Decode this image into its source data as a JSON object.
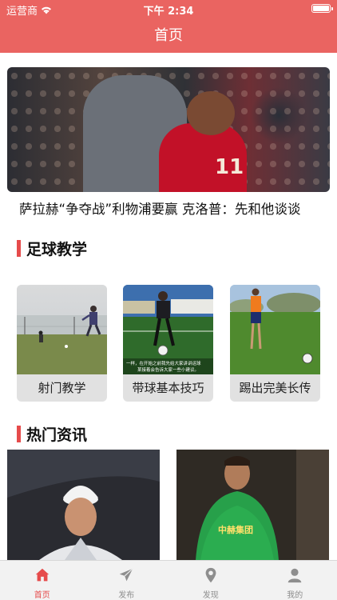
{
  "status_bar": {
    "carrier": "运营商",
    "time": "下午 2:34"
  },
  "header": {
    "title": "首页"
  },
  "hero": {
    "headline": "萨拉赫“争夺战”利物浦要赢 克洛普：先和他谈谈",
    "jersey_text": "11"
  },
  "sections": {
    "tutorials_title": "足球教学",
    "news_title": "热门资讯"
  },
  "tutorials": [
    {
      "label": "射门教学"
    },
    {
      "label": "带球基本技巧"
    },
    {
      "label": "踢出完美长传"
    }
  ],
  "tutorial_captions": {
    "card2": "一样，在开始之前我先给大家讲讲运球... 某接着会告诉大家一些小建议。"
  },
  "news_cards": [
    {
      "image": "coach-portrait"
    },
    {
      "image": "player-green-jersey",
      "shirt_text": "中赫集团"
    }
  ],
  "tab_bar": {
    "items": [
      {
        "label": "首页",
        "icon": "home-icon",
        "active": true
      },
      {
        "label": "发布",
        "icon": "send-icon",
        "active": false
      },
      {
        "label": "发现",
        "icon": "location-pin-icon",
        "active": false
      },
      {
        "label": "我的",
        "icon": "person-icon",
        "active": false
      }
    ]
  },
  "colors": {
    "brand": "#ea6461",
    "accent": "#e64b4b",
    "tab_inactive": "#8e8e8e"
  }
}
